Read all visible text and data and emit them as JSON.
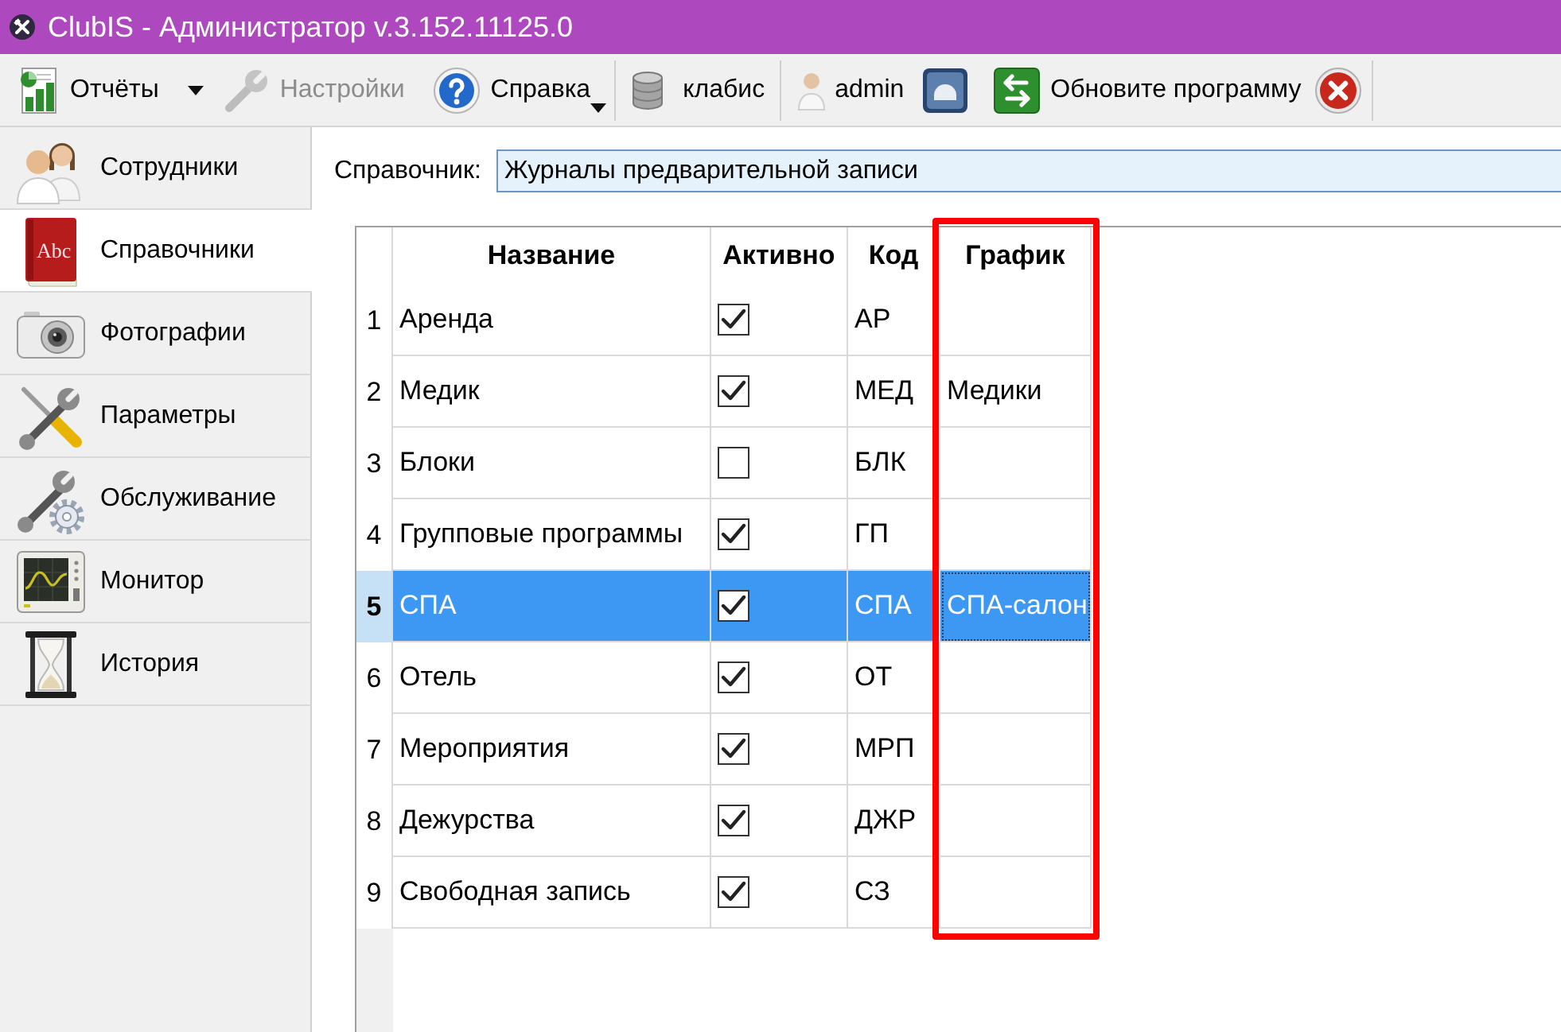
{
  "window": {
    "title": "ClubIS - Администратор v.3.152.11125.0"
  },
  "toolbar": [
    {
      "kind": "button",
      "label": "Отчёты",
      "disabled": false
    },
    {
      "kind": "dropdown",
      "disabled": false
    },
    {
      "kind": "button",
      "label": "Настройки",
      "disabled": true
    },
    {
      "kind": "menu_button",
      "label": "Справка",
      "disabled": false
    },
    {
      "kind": "separator"
    },
    {
      "kind": "button",
      "label": "клабис",
      "disabled": false
    },
    {
      "kind": "separator"
    },
    {
      "kind": "button",
      "label": "admin",
      "disabled": false
    },
    {
      "kind": "icon_button",
      "disabled": false
    },
    {
      "kind": "button",
      "label": "Обновите программу",
      "disabled": false
    },
    {
      "kind": "icon_button",
      "disabled": false
    },
    {
      "kind": "separator"
    }
  ],
  "sidebar": {
    "items": [
      {
        "label": "Сотрудники",
        "selected": false
      },
      {
        "label": "Справочники",
        "selected": true,
        "icon_text": "Abc"
      },
      {
        "label": "Фотографии",
        "selected": false
      },
      {
        "label": "Параметры",
        "selected": false
      },
      {
        "label": "Обслуживание",
        "selected": false
      },
      {
        "label": "Монитор",
        "selected": false
      },
      {
        "label": "История",
        "selected": false
      }
    ]
  },
  "directory": {
    "label": "Справочник:",
    "value": "Журналы предварительной записи"
  },
  "table": {
    "columns": [
      {
        "label": "Название",
        "highlighted": false
      },
      {
        "label": "Активно",
        "highlighted": false
      },
      {
        "label": "Код",
        "highlighted": false
      },
      {
        "label": "График",
        "highlighted": true
      }
    ],
    "rows": [
      {
        "number": "1",
        "name": "Аренда",
        "active": true,
        "code": "АР",
        "selected": false
      },
      {
        "number": "2",
        "name": "Медик",
        "active": true,
        "code": "МЕД",
        "schedule": "Медики",
        "selected": false
      },
      {
        "number": "3",
        "name": "Блоки",
        "active": false,
        "code": "БЛК",
        "selected": false
      },
      {
        "number": "4",
        "name": "Групповые программы",
        "active": true,
        "code": "ГП",
        "selected": false
      },
      {
        "number": "5",
        "name": "СПА",
        "active": true,
        "code": "СПА",
        "schedule": "СПА-салон",
        "selected": true
      },
      {
        "number": "6",
        "name": "Отель",
        "active": true,
        "code": "ОТ",
        "selected": false
      },
      {
        "number": "7",
        "name": "Мероприятия",
        "active": true,
        "code": "МРП",
        "selected": false
      },
      {
        "number": "8",
        "name": "Дежурства",
        "active": true,
        "code": "ДЖР",
        "selected": false
      },
      {
        "number": "9",
        "name": "Свободная запись",
        "active": true,
        "code": "СЗ",
        "selected": false
      }
    ]
  }
}
